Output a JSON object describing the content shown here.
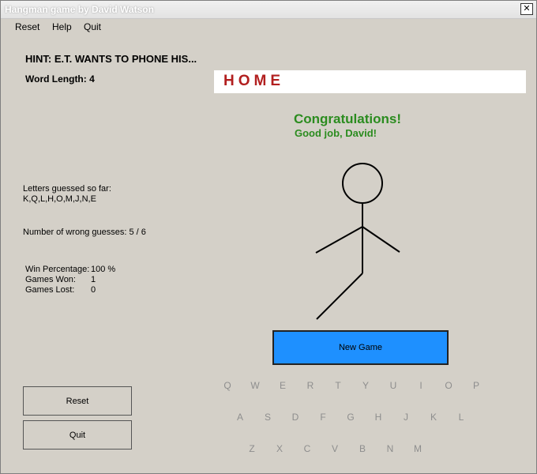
{
  "window": {
    "title": "Hangman game by David Watson",
    "close_glyph": "✕"
  },
  "menu": [
    {
      "label": "Reset"
    },
    {
      "label": "Help"
    },
    {
      "label": "Quit"
    }
  ],
  "hint": "HINT: E.T. WANTS TO PHONE HIS...",
  "word_length_label": "Word Length: 4",
  "word": "HOME",
  "message": {
    "title": "Congratulations!",
    "subtitle": "Good job, David!"
  },
  "letters_guessed": {
    "label": "Letters guessed so far:",
    "value": "K,Q,L,H,O,M,J,N,E"
  },
  "wrong_guesses": "Number of wrong guesses: 5 / 6",
  "wrong_count": 5,
  "max_wrong": 6,
  "stats": {
    "win_pct_label": "Win Percentage:",
    "win_pct_value": "100 %",
    "won_label": "Games Won:",
    "won_value": "1",
    "lost_label": "Games Lost:",
    "lost_value": "0"
  },
  "new_game_label": "New Game",
  "keyboard": {
    "row1": [
      "Q",
      "W",
      "E",
      "R",
      "T",
      "Y",
      "U",
      "I",
      "O",
      "P"
    ],
    "row2": [
      "A",
      "S",
      "D",
      "F",
      "G",
      "H",
      "J",
      "K",
      "L"
    ],
    "row3": [
      "Z",
      "X",
      "C",
      "V",
      "B",
      "N",
      "M"
    ]
  },
  "buttons": {
    "reset": "Reset",
    "quit": "Quit"
  },
  "colors": {
    "word": "#b21f1f",
    "congrats": "#2b8c1f",
    "new_game": "#1e90ff",
    "background": "#d4d0c8"
  }
}
